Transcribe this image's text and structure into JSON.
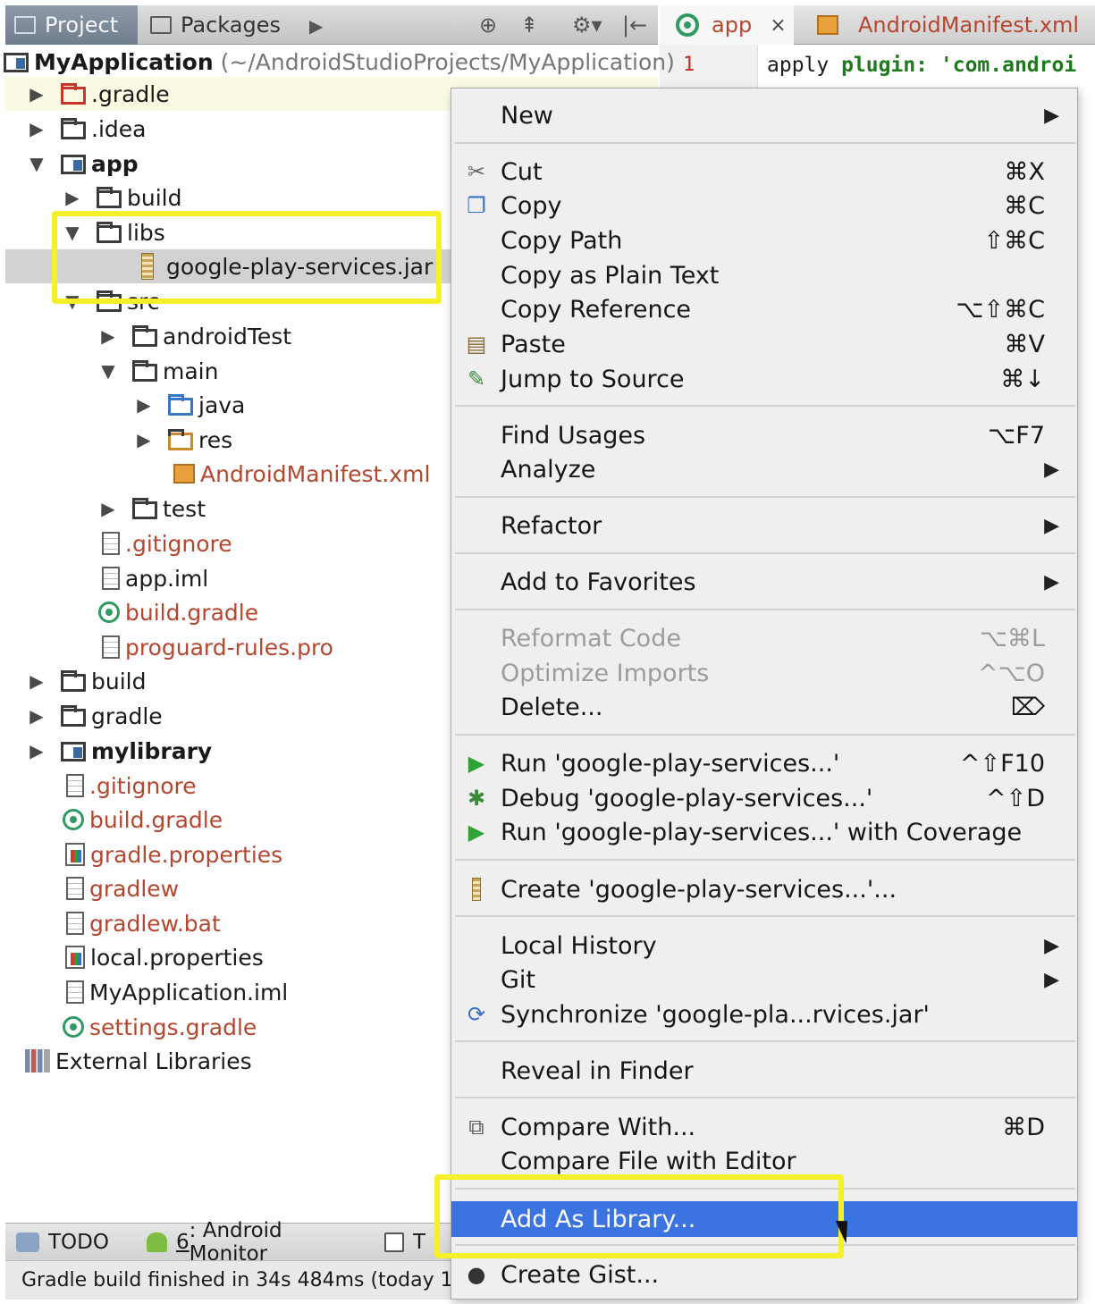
{
  "project_toolbar": {
    "project_tab": "Project",
    "packages_tab": "Packages",
    "expand_glyph": "▶",
    "target_glyph": "⊕",
    "collapse_glyph": "⇞",
    "settings_glyph": "⚙▾",
    "hide_glyph": "|←"
  },
  "editor_tabs": {
    "app_tab": "app",
    "close_glyph": "×",
    "manifest_tab": "AndroidManifest.xml"
  },
  "editor": {
    "line_number": "1",
    "code_plain": "apply ",
    "code_keyword": "plugin:",
    "code_string": " 'com.androi"
  },
  "tree": {
    "root_name": "MyApplication",
    "root_path": "(~/AndroidStudioProjects/MyApplication)",
    "items": [
      {
        "label": ".gradle"
      },
      {
        "label": ".idea"
      },
      {
        "label": "app"
      },
      {
        "label": "build"
      },
      {
        "label": "libs"
      },
      {
        "label": "google-play-services.jar"
      },
      {
        "label": "src"
      },
      {
        "label": "androidTest"
      },
      {
        "label": "main"
      },
      {
        "label": "java"
      },
      {
        "label": "res"
      },
      {
        "label": "AndroidManifest.xml"
      },
      {
        "label": "test"
      },
      {
        "label": ".gitignore"
      },
      {
        "label": "app.iml"
      },
      {
        "label": "build.gradle"
      },
      {
        "label": "proguard-rules.pro"
      },
      {
        "label": "build"
      },
      {
        "label": "gradle"
      },
      {
        "label": "mylibrary"
      },
      {
        "label": ".gitignore"
      },
      {
        "label": "build.gradle"
      },
      {
        "label": "gradle.properties"
      },
      {
        "label": "gradlew"
      },
      {
        "label": "gradlew.bat"
      },
      {
        "label": "local.properties"
      },
      {
        "label": "MyApplication.iml"
      },
      {
        "label": "settings.gradle"
      },
      {
        "label": "External Libraries"
      }
    ]
  },
  "bottom_tools": {
    "todo": "TODO",
    "monitor_hotkey": "6",
    "monitor_label": ": Android Monitor",
    "terminal_initial": "T"
  },
  "status": "Gradle build finished in 34s 484ms (today 1:",
  "menu": {
    "new": "New",
    "cut": "Cut",
    "cut_sc": "⌘X",
    "copy": "Copy",
    "copy_sc": "⌘C",
    "copy_path": "Copy Path",
    "copy_path_sc": "⇧⌘C",
    "copy_plain": "Copy as Plain Text",
    "copy_ref": "Copy Reference",
    "copy_ref_sc": "⌥⇧⌘C",
    "paste": "Paste",
    "paste_sc": "⌘V",
    "jump": "Jump to Source",
    "jump_sc": "⌘↓",
    "find_usages": "Find Usages",
    "find_usages_sc": "⌥F7",
    "analyze": "Analyze",
    "refactor": "Refactor",
    "favorites": "Add to Favorites",
    "reformat": "Reformat Code",
    "reformat_sc": "⌥⌘L",
    "optimize": "Optimize Imports",
    "optimize_sc": "^⌥O",
    "delete": "Delete...",
    "delete_sc": "⌦",
    "run": "Run 'google-play-services...'",
    "run_sc": "^⇧F10",
    "debug": "Debug 'google-play-services...'",
    "debug_sc": "^⇧D",
    "coverage": "Run 'google-play-services...' with Coverage",
    "create": "Create 'google-play-services...'...",
    "local_history": "Local History",
    "git": "Git",
    "sync": "Synchronize 'google-pla...rvices.jar'",
    "reveal": "Reveal in Finder",
    "compare_with": "Compare With...",
    "compare_with_sc": "⌘D",
    "compare_editor": "Compare File with Editor",
    "add_library": "Add As Library...",
    "create_gist": "Create Gist...",
    "submenu_arrow": "▶"
  },
  "colors": {
    "selection_blue": "#3b73e0",
    "annotation_yellow": "#f5f02a",
    "vcs_orange": "#b5462f",
    "gradle_green": "#2f9a62"
  },
  "icons": {
    "cut": "scissors-icon",
    "copy": "copy-icon",
    "paste": "paste-icon",
    "jump": "jump-to-source-icon",
    "run": "run-icon",
    "debug": "debug-icon",
    "coverage": "coverage-icon",
    "create": "jar-icon",
    "sync": "sync-icon",
    "compare": "compare-icon",
    "gist": "github-icon"
  }
}
